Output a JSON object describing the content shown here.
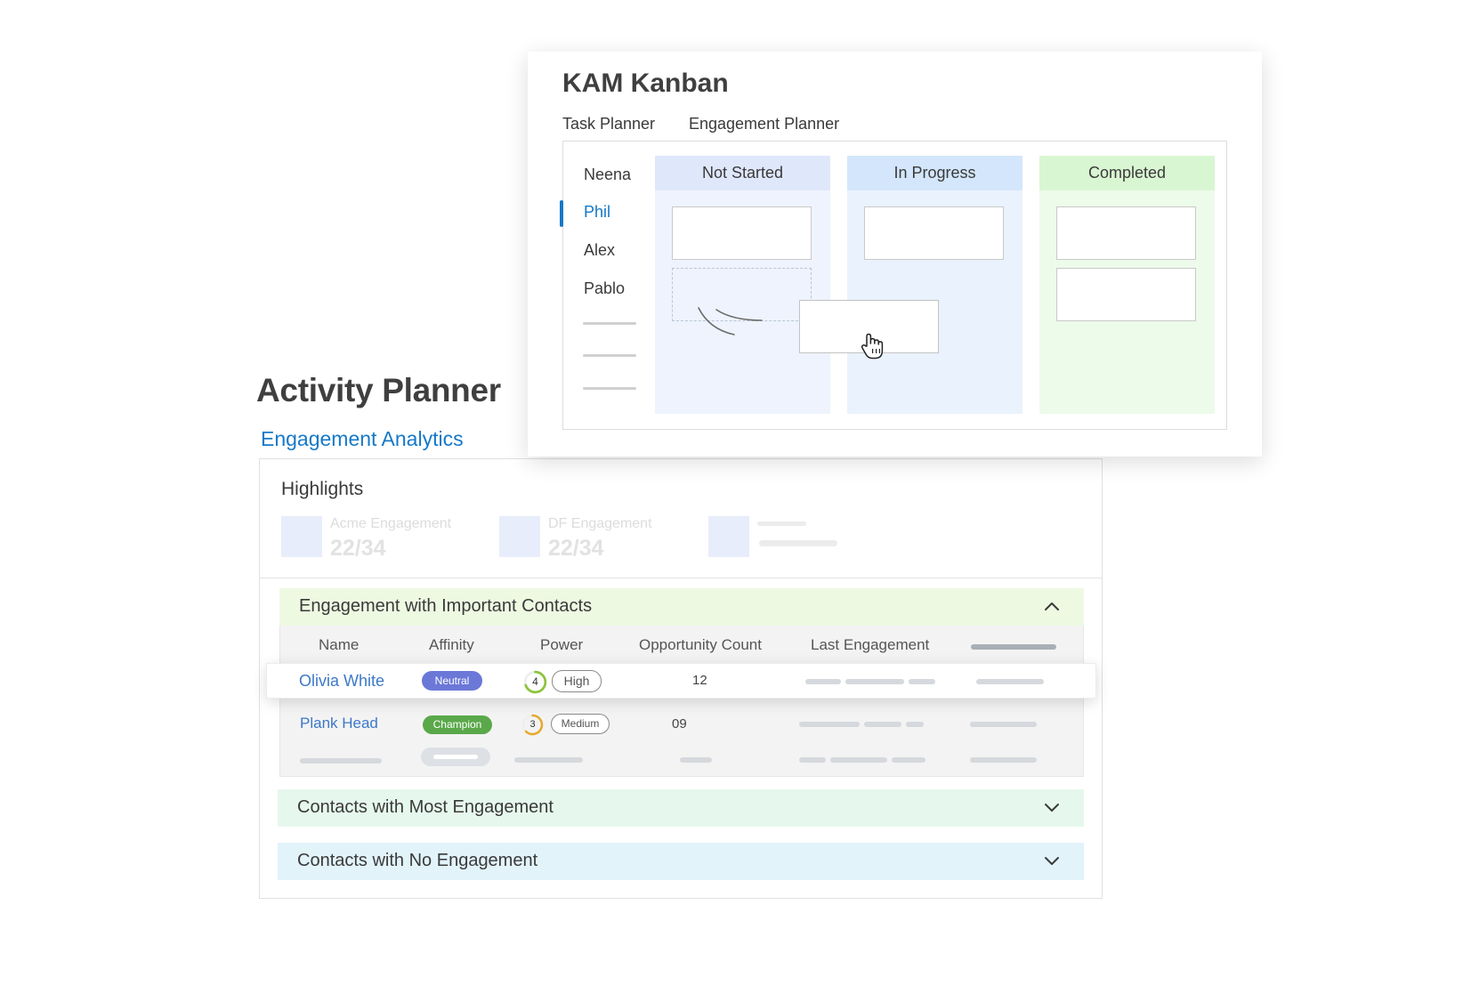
{
  "activity_planner": {
    "title": "Activity Planner",
    "subtitle": "Engagement Analytics",
    "highlights": {
      "title": "Highlights",
      "items": [
        {
          "label": "Acme Engagement",
          "value": "22/34"
        },
        {
          "label": "DF Engagement",
          "value": "22/34"
        }
      ]
    },
    "sections": [
      {
        "title": "Engagement with Important Contacts",
        "expanded": true
      },
      {
        "title": "Contacts with Most Engagement",
        "expanded": false
      },
      {
        "title": "Contacts with No Engagement",
        "expanded": false
      }
    ],
    "table": {
      "columns": [
        "Name",
        "Affinity",
        "Power",
        "Opportunity Count",
        "Last Engagement"
      ],
      "rows": [
        {
          "name": "Olivia White",
          "affinity": "Neutral",
          "power_level": "4",
          "power_label": "High",
          "opportunity_count": "12"
        },
        {
          "name": "Plank Head",
          "affinity": "Champion",
          "power_level": "3",
          "power_label": "Medium",
          "opportunity_count": "09"
        }
      ]
    }
  },
  "kam_kanban": {
    "title": "KAM Kanban",
    "tabs": [
      "Task Planner",
      "Engagement Planner"
    ],
    "people": [
      "Neena",
      "Phil",
      "Alex",
      "Pablo"
    ],
    "active_person": "Phil",
    "columns": [
      {
        "title": "Not Started",
        "cards": 1
      },
      {
        "title": "In Progress",
        "cards": 1
      },
      {
        "title": "Completed",
        "cards": 2
      }
    ]
  },
  "colors": {
    "accent_blue": "#1678c8",
    "link_blue": "#3c78c8",
    "neutral_badge": "#6b78d8",
    "champion_badge": "#5aa84a",
    "not_started_header": "#dfe7fb",
    "in_progress_header": "#d3e6fb",
    "completed_header": "#d9f6d2"
  },
  "icons": {
    "collapse": "chevron-up-icon",
    "expand": "chevron-down-icon",
    "cursor": "grab-hand-icon"
  }
}
